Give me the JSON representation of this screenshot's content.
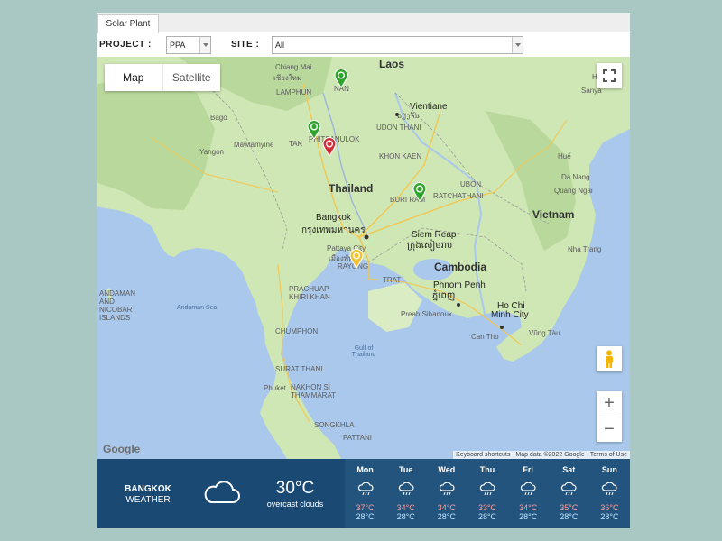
{
  "tab": {
    "label": "Solar Plant"
  },
  "filters": {
    "project_label": "PROJECT :",
    "project_value": "PPA",
    "site_label": "SITE :",
    "site_value": "All"
  },
  "map": {
    "map_type_buttons": [
      "Map",
      "Satellite"
    ],
    "labels": {
      "laos": "Laos",
      "thailand": "Thailand",
      "cambodia": "Cambodia",
      "vietnam": "Vietnam",
      "chiang_mai": "Chiang Mai",
      "chiang_mai_th": "เชียงใหม่",
      "lamphun": "LAMPHUN",
      "nan": "NAN",
      "vientiane": "Vientiane",
      "vientiane_lo": "ວຽງຈັນ",
      "udon": "UDON THANI",
      "khon_kaen": "KHON KAEN",
      "tak": "TAK",
      "phitsanulok": "PHITSANULOK",
      "ubon": "UBON",
      "ratchathani": "RATCHATHANI",
      "buri_ram": "BURI RAM",
      "bangkok": "Bangkok",
      "bangkok_th": "กรุงเทพมหานคร",
      "pattaya": "Pattaya City",
      "pattaya_th": "เมืองพัทยา",
      "rayong": "RAYONG",
      "trat": "TRAT",
      "siem_reap": "Siem Reap",
      "siem_reap_km": "ក្រុងសៀមរាប",
      "phnom_penh": "Phnom Penh",
      "phnom_penh_km": "ភ្នំពេញ",
      "ho_chi_minh": "Ho Chi",
      "ho_chi_minh2": "Minh City",
      "mawlamyine": "Mawlamyine",
      "yangon": "Yangon",
      "bago": "Bago",
      "hue": "Huế",
      "da_nang": "Da Nang",
      "quang_ngai": "Quảng Ngãi",
      "nha_trang": "Nha Trang",
      "sanya": "Sanya",
      "hainan": "Hainan",
      "andaman_islands": "ANDAMAN AND NICOBAR ISLANDS",
      "andaman_sea": "Andaman Sea",
      "gulf": "Gulf of Thailand",
      "chumphon": "CHUMPHON",
      "surat": "SURAT THANI",
      "prachuap": "PRACHUAP KHIRI KHAN",
      "nakhon": "NAKHON SI THAMMARAT",
      "phuket": "Phuket",
      "songkhla": "SONGKHLA",
      "pattani": "PATTANI",
      "can_tho": "Can Tho",
      "vung_tau": "Vũng Tàu",
      "preah": "Preah Sihanouk"
    },
    "attribution": {
      "shortcuts": "Keyboard shortcuts",
      "data": "Map data ©2022 Google",
      "terms": "Terms of Use"
    },
    "logo": "Google",
    "markers": [
      {
        "color": "#2fa52b",
        "name": "plant-marker-nan"
      },
      {
        "color": "#2fa52b",
        "name": "plant-marker-phitsanulok"
      },
      {
        "color": "#d32f3a",
        "name": "plant-marker-phitsanulok-alert"
      },
      {
        "color": "#2fa52b",
        "name": "plant-marker-buriram"
      },
      {
        "color": "#f1c232",
        "name": "plant-marker-rayong"
      }
    ]
  },
  "weather": {
    "city": "BANGKOK",
    "label": "WEATHER",
    "temperature": "30°C",
    "description": "overcast clouds",
    "days": [
      {
        "day": "Mon",
        "high": "37°C",
        "low": "28°C"
      },
      {
        "day": "Tue",
        "high": "34°C",
        "low": "28°C"
      },
      {
        "day": "Wed",
        "high": "34°C",
        "low": "28°C"
      },
      {
        "day": "Thu",
        "high": "33°C",
        "low": "28°C"
      },
      {
        "day": "Fri",
        "high": "34°C",
        "low": "28°C"
      },
      {
        "day": "Sat",
        "high": "35°C",
        "low": "28°C"
      },
      {
        "day": "Sun",
        "high": "36°C",
        "low": "28°C"
      }
    ]
  }
}
